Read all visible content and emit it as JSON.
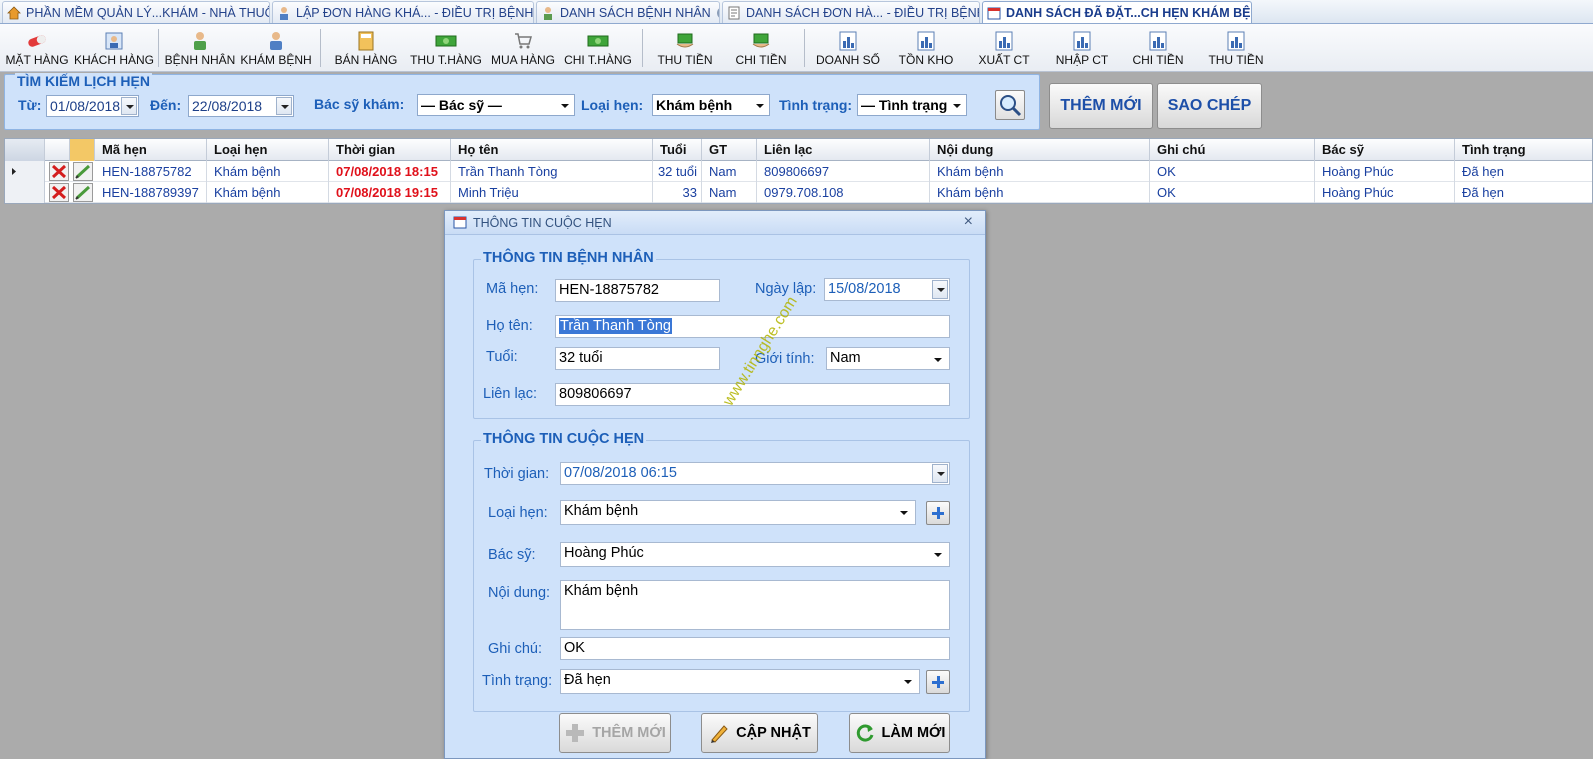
{
  "tabs": [
    {
      "label": "PHẦN MỀM QUẢN LÝ...KHÁM - NHÀ THUỐC",
      "icon": "home-icon"
    },
    {
      "label": "LẬP ĐƠN HÀNG KHÁ... - ĐIỀU TRỊ BỆNH",
      "icon": "doctor-icon"
    },
    {
      "label": "DANH SÁCH BỆNH NHÂN",
      "icon": "patient-icon"
    },
    {
      "label": "DANH SÁCH ĐƠN HÀ... - ĐIỀU TRỊ BỆNH",
      "icon": "order-list-icon"
    },
    {
      "label": "DANH SÁCH ĐÃ ĐẶT...CH HẸN KHÁM BỆNH",
      "icon": "calendar-icon"
    }
  ],
  "toolbar": [
    "MẶT HÀNG",
    "KHÁCH HÀNG",
    "BỆNH NHÂN",
    "KHÁM BỆNH",
    "BÁN HÀNG",
    "THU T.HÀNG",
    "MUA HÀNG",
    "CHI T.HÀNG",
    "THU TIỀN",
    "CHI TIỀN",
    "DOANH SỐ",
    "TỒN KHO",
    "XUẤT CT",
    "NHẬP CT",
    "CHI TIỀN",
    "THU TIỀN"
  ],
  "search": {
    "legend": "TÌM KIẾM LỊCH HẸN",
    "from_label": "Từ:",
    "from_value": "01/08/2018",
    "to_label": "Đến:",
    "to_value": "22/08/2018",
    "doctor_label": "Bác sỹ khám:",
    "doctor_value": "— Bác sỹ —",
    "type_label": "Loại hẹn:",
    "type_value": "Khám bệnh",
    "status_label": "Tình trạng:",
    "status_value": "— Tình trạng"
  },
  "actions": {
    "add_new": "THÊM MỚI",
    "copy": "SAO CHÉP"
  },
  "grid": {
    "columns": [
      "Mã hẹn",
      "Loại hẹn",
      "Thời gian",
      "Họ tên",
      "Tuổi",
      "GT",
      "Liên lạc",
      "Nội dung",
      "Ghi chú",
      "Bác sỹ",
      "Tình trạng"
    ],
    "rows": [
      {
        "code": "HEN-18875782",
        "type": "Khám bệnh",
        "time": "07/08/2018 18:15",
        "name": "Trần Thanh Tòng",
        "age": "32 tuổi",
        "gender": "Nam",
        "contact": "809806697",
        "content": "Khám bệnh",
        "note": "OK",
        "doctor": "Hoàng Phúc",
        "status": "Đã hẹn"
      },
      {
        "code": "HEN-188789397",
        "type": "Khám bệnh",
        "time": "07/08/2018 19:15",
        "name": "Minh Triệu",
        "age": "33",
        "gender": "Nam",
        "contact": "0979.708.108",
        "content": "Khám bệnh",
        "note": "OK",
        "doctor": "Hoàng Phúc",
        "status": "Đã hẹn"
      }
    ]
  },
  "dialog": {
    "title": "THÔNG TIN CUỘC HẸN",
    "patient_group": "THÔNG TIN BỆNH NHÂN",
    "code_label": "Mã hẹn:",
    "code_value": "HEN-18875782",
    "date_label": "Ngày lập:",
    "date_value": "15/08/2018",
    "name_label": "Họ tên:",
    "name_value": "Trần Thanh Tòng",
    "age_label": "Tuổi:",
    "age_value": "32 tuổi",
    "gender_label": "Giới tính:",
    "gender_value": "Nam",
    "contact_label": "Liên lạc:",
    "contact_value": "809806697",
    "appt_group": "THÔNG TIN CUỘC HẸN",
    "time_label": "Thời gian:",
    "time_value": "07/08/2018  06:15",
    "type_label": "Loại hẹn:",
    "type_value": "Khám bệnh",
    "doctor_label": "Bác sỹ:",
    "doctor_value": "Hoàng Phúc",
    "content_label": "Nội dung:",
    "content_value": "Khám bệnh",
    "note_label": "Ghi chú:",
    "note_value": "OK",
    "status_label": "Tình trạng:",
    "status_value": "Đã hẹn",
    "btn_add": "THÊM MỚI",
    "btn_update": "CẬP NHẬT",
    "btn_refresh": "LÀM MỚI"
  },
  "watermark": "www.tinnghe.com"
}
